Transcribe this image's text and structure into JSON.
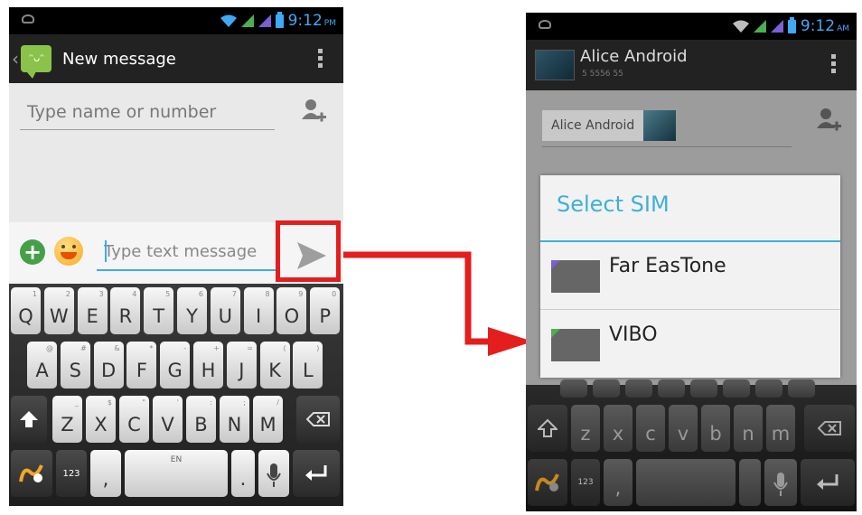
{
  "left_phone": {
    "status": {
      "time": "9:12",
      "ampm": "PM"
    },
    "action_bar": {
      "title": "New message"
    },
    "recipient": {
      "placeholder": "Type name or number"
    },
    "message": {
      "placeholder": "Type text message"
    },
    "keyboard": {
      "row1": [
        {
          "label": "Q",
          "sub": "1"
        },
        {
          "label": "W",
          "sub": "2"
        },
        {
          "label": "E",
          "sub": "3"
        },
        {
          "label": "R",
          "sub": "4"
        },
        {
          "label": "T",
          "sub": "5"
        },
        {
          "label": "Y",
          "sub": "6"
        },
        {
          "label": "U",
          "sub": "7"
        },
        {
          "label": "I",
          "sub": "8"
        },
        {
          "label": "O",
          "sub": "9"
        },
        {
          "label": "P",
          "sub": "0"
        }
      ],
      "row2": [
        {
          "label": "A",
          "sub": "@"
        },
        {
          "label": "S",
          "sub": "#"
        },
        {
          "label": "D",
          "sub": "&"
        },
        {
          "label": "F",
          "sub": "*"
        },
        {
          "label": "G",
          "sub": "-"
        },
        {
          "label": "H",
          "sub": "+"
        },
        {
          "label": "J",
          "sub": "="
        },
        {
          "label": "K",
          "sub": "("
        },
        {
          "label": "L",
          "sub": ")"
        }
      ],
      "row3": [
        {
          "label": "Z",
          "sub": "_"
        },
        {
          "label": "X",
          "sub": "$"
        },
        {
          "label": "C",
          "sub": "\""
        },
        {
          "label": "V",
          "sub": "'"
        },
        {
          "label": "B",
          "sub": ":"
        },
        {
          "label": "N",
          "sub": ";"
        },
        {
          "label": "M",
          "sub": "/"
        }
      ],
      "symbols_label": "123",
      "comma_label": ",",
      "space_label": "EN",
      "period_label": "."
    }
  },
  "right_phone": {
    "status": {
      "time": "9:12",
      "ampm": "AM"
    },
    "action_bar": {
      "contact_name": "Alice Android",
      "contact_number": "5 5556 55"
    },
    "recipient_chip": "Alice Android",
    "dialog": {
      "title": "Select SIM",
      "options": [
        {
          "name": "Far EasTone",
          "corner_color": "#7b5fd6"
        },
        {
          "name": "VIBO",
          "corner_color": "#4caf50"
        }
      ]
    },
    "keyboard": {
      "row3": [
        "z",
        "x",
        "c",
        "v",
        "b",
        "n",
        "m"
      ],
      "symbols_label": "123",
      "comma_label": ","
    }
  },
  "colors": {
    "highlight": "#e41d1d",
    "accent": "#3fa9f5",
    "dialog_accent": "#3fb0d8"
  },
  "icons": [
    "send-icon",
    "add-contact-icon",
    "plus-icon",
    "emoji-icon",
    "shift-icon",
    "backspace-icon",
    "enter-icon",
    "mic-icon",
    "swype-icon",
    "wifi-icon",
    "signal-icon",
    "battery-icon",
    "overflow-menu-icon",
    "back-chevron-icon"
  ]
}
